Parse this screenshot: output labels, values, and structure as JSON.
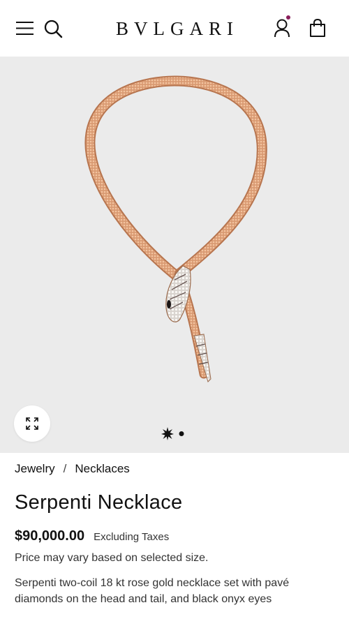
{
  "header": {
    "brand": "BVLGARI",
    "icons": [
      "menu-icon",
      "search-icon",
      "account-icon",
      "bag-icon"
    ],
    "account_dot_color": "#8a1e5b"
  },
  "gallery": {
    "background": "#ebebeb",
    "image": "serpenti-necklace-rose-gold",
    "slide_count": 2,
    "active_slide": 1
  },
  "product": {
    "breadcrumb": [
      "Jewelry",
      "Necklaces"
    ],
    "breadcrumb_separator": "/",
    "name": "Serpenti Necklace",
    "price": "$90,000.00",
    "tax_note": "Excluding Taxes",
    "price_note": "Price may vary based on selected size.",
    "description": "Serpenti two-coil 18 kt rose gold necklace set with pavé diamonds on the head and tail, and black onyx eyes"
  }
}
